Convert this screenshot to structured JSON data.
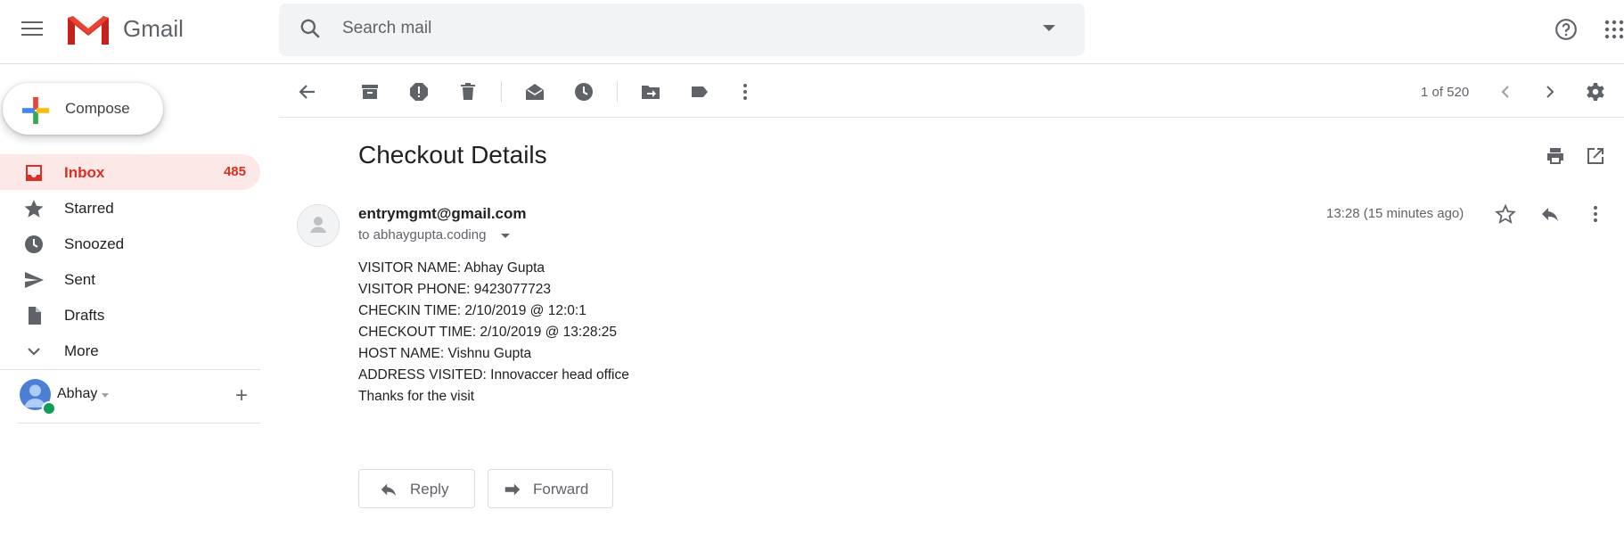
{
  "app": {
    "name": "Gmail"
  },
  "header": {
    "search_placeholder": "Search mail"
  },
  "compose": {
    "label": "Compose"
  },
  "nav": {
    "items": [
      {
        "label": "Inbox",
        "count": "485",
        "icon": "inbox-icon",
        "active": true
      },
      {
        "label": "Starred",
        "icon": "star-icon"
      },
      {
        "label": "Snoozed",
        "icon": "clock-icon"
      },
      {
        "label": "Sent",
        "icon": "send-icon"
      },
      {
        "label": "Drafts",
        "icon": "draft-icon"
      },
      {
        "label": "More",
        "icon": "chevron-down-icon"
      }
    ]
  },
  "account": {
    "name": "Abhay",
    "add_symbol": "+"
  },
  "toolbar": {
    "pager": "1 of 520"
  },
  "email": {
    "subject": "Checkout Details",
    "sender": "entrymgmt@gmail.com",
    "to": "to abhaygupta.coding",
    "timestamp": "13:28 (15 minutes ago)",
    "body": [
      "VISITOR NAME: Abhay Gupta",
      "VISITOR PHONE: 9423077723",
      "CHECKIN TIME: 2/10/2019 @ 12:0:1",
      "CHECKOUT TIME: 2/10/2019 @ 13:28:25",
      "HOST NAME: Vishnu Gupta",
      "ADDRESS VISITED: Innovaccer head office",
      "Thanks for the visit"
    ]
  },
  "actions": {
    "reply_label": "Reply",
    "forward_label": "Forward"
  },
  "colors": {
    "accent_red": "#d93025",
    "active_bg": "#fce8e6",
    "icon_gray": "#5f6368"
  }
}
